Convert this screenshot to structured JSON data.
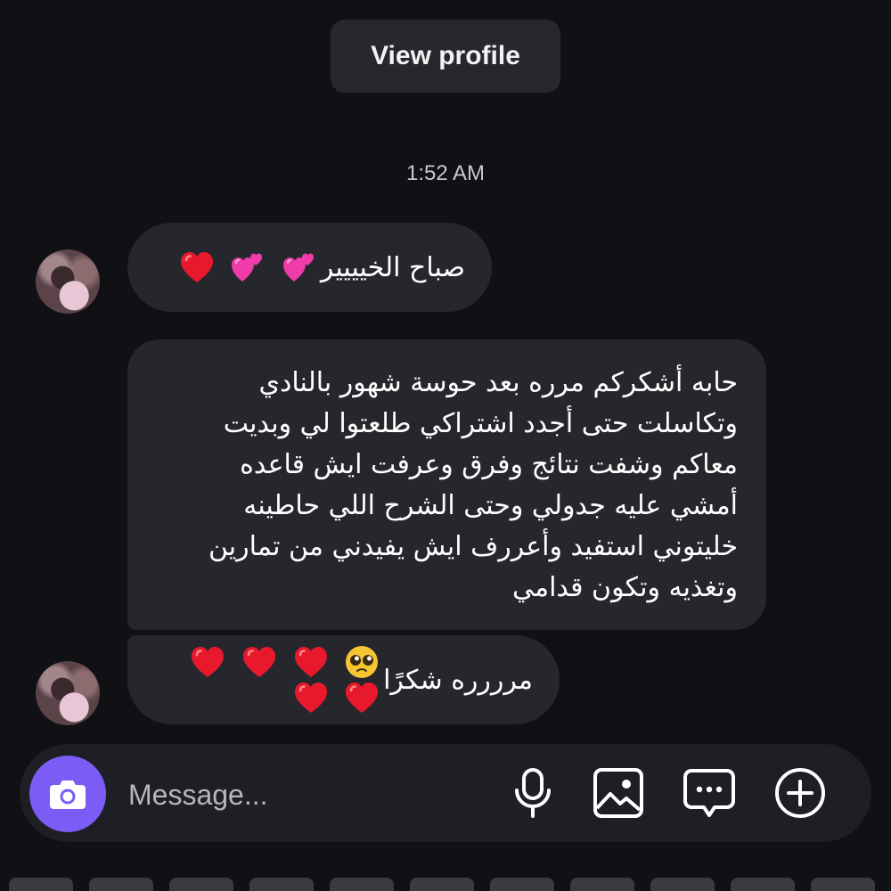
{
  "header": {
    "view_profile_label": "View profile"
  },
  "conversation": {
    "timestamp": "1:52 AM",
    "messages": [
      {
        "text": "صباح الخيييير",
        "emojis": [
          "two-hearts",
          "two-hearts",
          "red-heart"
        ]
      },
      {
        "lines": [
          "حابه أشكركم مرره بعد حوسة شهور بالنادي",
          "وتكاسلت حتى أجدد اشتراكي طلعتوا لي وبديت",
          "معاكم وشفت نتائج وفرق وعرفت ايش قاعده",
          "أمشي عليه جدولي وحتى الشرح اللي حاطينه",
          "خليتوني استفيد وأعررف ايش يفيدني من تمارين",
          "وتغذيه وتكون قدامي"
        ]
      },
      {
        "text": "مرررره شكرًا",
        "emojis": [
          "pleading-face",
          "red-heart",
          "red-heart",
          "red-heart",
          "red-heart",
          "red-heart"
        ]
      }
    ]
  },
  "composer": {
    "placeholder": "Message...",
    "icons": [
      "camera-icon",
      "microphone-icon",
      "gallery-icon",
      "sticker-icon",
      "add-icon"
    ]
  },
  "colors": {
    "background": "#101015",
    "bubble": "#26272c",
    "accent": "#7b5cf5",
    "heart_red": "#e8192c",
    "heart_pink": "#f03ca8"
  }
}
